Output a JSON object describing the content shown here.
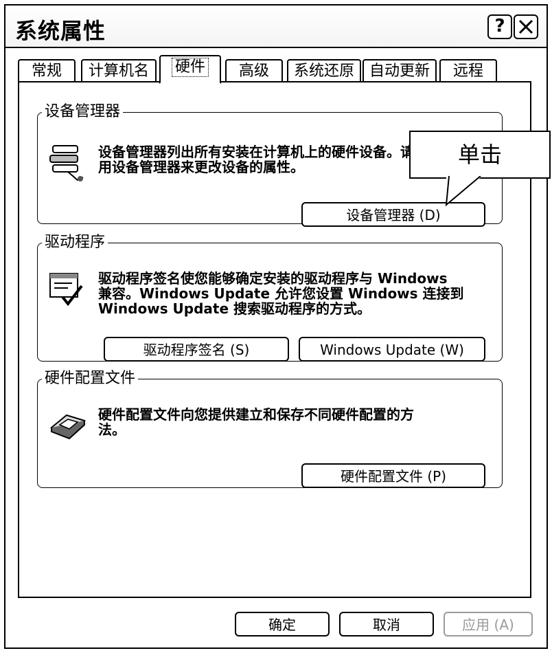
{
  "window": {
    "title": "系统属性"
  },
  "tabs": [
    {
      "label": "常规"
    },
    {
      "label": "计算机名"
    },
    {
      "label": "硬件",
      "active": true
    },
    {
      "label": "高级"
    },
    {
      "label": "系统还原"
    },
    {
      "label": "自动更新"
    },
    {
      "label": "远程"
    }
  ],
  "groups": {
    "device_manager": {
      "title": "设备管理器",
      "description_line1": "设备管理器列出所有安装在计算机上的硬件设备。请使",
      "description_line2": "用设备管理器来更改设备的属性。",
      "button_label": "设备管理器 (D)"
    },
    "driver": {
      "title": "驱动程序",
      "description_line1": "驱动程序签名使您能够确定安装的驱动程序与 Windows",
      "description_line2": "兼容。Windows Update 允许您设置 Windows 连接到",
      "description_line3": "Windows Update 搜索驱动程序的方式。",
      "signing_button_label": "驱动程序签名 (S)",
      "update_button_label": "Windows Update (W)"
    },
    "hardware_profiles": {
      "title": "硬件配置文件",
      "description_line1": "硬件配置文件向您提供建立和保存不同硬件配置的方",
      "description_line2": "法。",
      "button_label": "硬件配置文件 (P)"
    }
  },
  "annotation": {
    "label": "单击"
  },
  "footer": {
    "ok_label": "确定",
    "cancel_label": "取消",
    "apply_label": "应用 (A)"
  }
}
